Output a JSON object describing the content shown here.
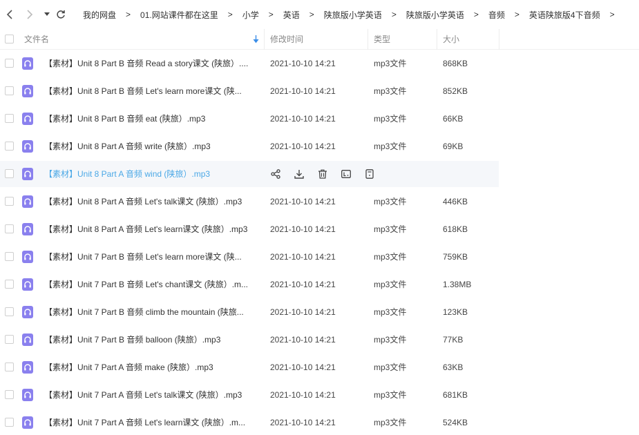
{
  "breadcrumb": [
    "我的网盘",
    "01.网站课件都在这里",
    "小学",
    "英语",
    "陕旅版小学英语",
    "陕旅版小学英语",
    "音频",
    "英语陕旅版4下音频"
  ],
  "separator": ">",
  "columns": {
    "name": "文件名",
    "modified": "修改时间",
    "type": "类型",
    "size": "大小"
  },
  "icons": {
    "back": "back-arrow-icon",
    "forward": "forward-arrow-icon",
    "history": "dropdown-icon",
    "refresh": "refresh-icon",
    "sort": "sort-desc-icon",
    "file": "audio-file-icon",
    "row_actions": [
      "share-icon",
      "download-icon",
      "delete-icon",
      "rename-icon",
      "more-icon"
    ]
  },
  "colors": {
    "file_icon": "#8a80ee",
    "link_hover": "#4ba8e6",
    "sort_arrow": "#3b8ee8",
    "hover_row": "#f5f7fa"
  },
  "hovered_row_index": 4,
  "files": [
    {
      "name": "【素材】Unit 8 Part B 音频 Read a story课文 (陕旅）....",
      "modified": "2021-10-10 14:21",
      "type": "mp3文件",
      "size": "868KB"
    },
    {
      "name": "【素材】Unit 8 Part B 音频 Let's learn more课文 (陕...",
      "modified": "2021-10-10 14:21",
      "type": "mp3文件",
      "size": "852KB"
    },
    {
      "name": "【素材】Unit 8 Part B 音频 eat (陕旅）.mp3",
      "modified": "2021-10-10 14:21",
      "type": "mp3文件",
      "size": "66KB"
    },
    {
      "name": "【素材】Unit 8 Part A 音频 write (陕旅）.mp3",
      "modified": "2021-10-10 14:21",
      "type": "mp3文件",
      "size": "69KB"
    },
    {
      "name": "【素材】Unit 8 Part A 音频 wind (陕旅）.mp3",
      "modified": "",
      "type": "",
      "size": ""
    },
    {
      "name": "【素材】Unit 8 Part A 音频 Let's talk课文 (陕旅）.mp3",
      "modified": "2021-10-10 14:21",
      "type": "mp3文件",
      "size": "446KB"
    },
    {
      "name": "【素材】Unit 8 Part A 音频 Let's learn课文 (陕旅）.mp3",
      "modified": "2021-10-10 14:21",
      "type": "mp3文件",
      "size": "618KB"
    },
    {
      "name": "【素材】Unit 7 Part B 音频 Let's learn more课文 (陕...",
      "modified": "2021-10-10 14:21",
      "type": "mp3文件",
      "size": "759KB"
    },
    {
      "name": "【素材】Unit 7 Part B 音频 Let's chant课文 (陕旅）.m...",
      "modified": "2021-10-10 14:21",
      "type": "mp3文件",
      "size": "1.38MB"
    },
    {
      "name": "【素材】Unit 7 Part B 音频 climb the mountain (陕旅...",
      "modified": "2021-10-10 14:21",
      "type": "mp3文件",
      "size": "123KB"
    },
    {
      "name": "【素材】Unit 7 Part B 音频 balloon (陕旅）.mp3",
      "modified": "2021-10-10 14:21",
      "type": "mp3文件",
      "size": "77KB"
    },
    {
      "name": "【素材】Unit 7 Part A 音频 make (陕旅）.mp3",
      "modified": "2021-10-10 14:21",
      "type": "mp3文件",
      "size": "63KB"
    },
    {
      "name": "【素材】Unit 7 Part A 音频  Let's talk课文 (陕旅）.mp3",
      "modified": "2021-10-10 14:21",
      "type": "mp3文件",
      "size": "681KB"
    },
    {
      "name": "【素材】Unit 7 Part A 音频  Let's learn课文 (陕旅）.m...",
      "modified": "2021-10-10 14:21",
      "type": "mp3文件",
      "size": "524KB"
    }
  ]
}
